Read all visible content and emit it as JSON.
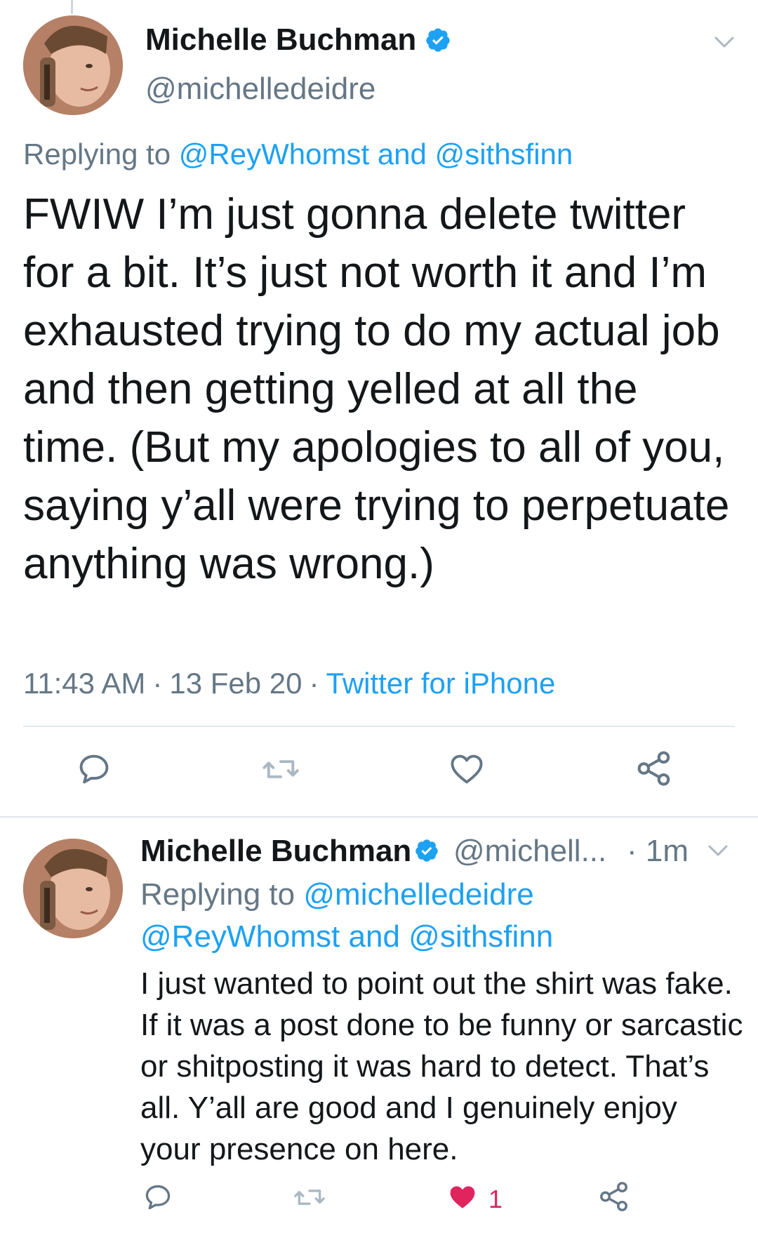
{
  "main_tweet": {
    "author_name": "Michelle Buchman",
    "author_handle": "@michelledeidre",
    "verified": true,
    "replying_to_prefix": "Replying to",
    "replying_to_user1": "@ReyWhomst",
    "replying_to_and": "and",
    "replying_to_user2": "@sithsfinn",
    "text": "FWIW I’m just gonna delete twitter for a bit. It’s just not worth it and I’m exhausted trying to do my actual job and then getting yelled at all the time. (But my apologies to all of you, saying y’all were trying to perpetuate anything was wrong.)",
    "time": "11:43 AM",
    "date": "13 Feb 20",
    "separator": "·",
    "source": "Twitter for iPhone",
    "icons": {
      "reply": "reply-icon",
      "retweet": "retweet-icon",
      "like": "heart-icon",
      "share": "share-icon",
      "menu": "chevron-down-icon"
    }
  },
  "reply_tweet": {
    "author_name": "Michelle Buchman",
    "author_handle": "@michell...",
    "time_separator": "·",
    "time": "1m",
    "verified": true,
    "replying_to_prefix": "Replying to",
    "replying_to_user1": "@michelledeidre",
    "replying_to_user2": "@ReyWhomst",
    "replying_to_and": "and",
    "replying_to_user3": "@sithsfinn",
    "text": "I just wanted to point out the shirt was fake. If it was a post done to be funny or sarcastic or shitposting it was hard to detect. That’s all. Y’all are good and I genuinely enjoy your presence on here.",
    "like_count": "1",
    "liked": true
  },
  "colors": {
    "text": "#14171a",
    "secondary": "#657786",
    "link": "#1da1f2",
    "like": "#e0245e",
    "divider": "#e1e8ed",
    "icon": "#657786"
  }
}
